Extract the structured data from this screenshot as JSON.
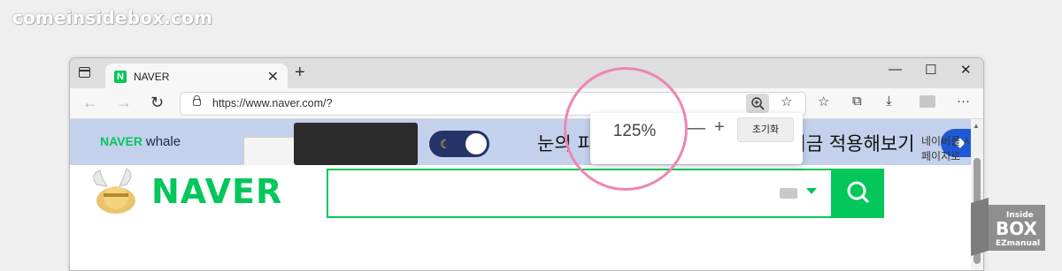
{
  "watermark": "comeinsidebox.com",
  "browser": {
    "tab": {
      "title": "NAVER",
      "favicon": "N",
      "close": "✕"
    },
    "new_tab": "+",
    "window_controls": [
      "—",
      "☐",
      "✕"
    ],
    "address": "https://www.naver.com/?",
    "nav": {
      "back": "←",
      "forward": "→",
      "refresh": "↻"
    },
    "toolbar_icons": {
      "favorites_add": "☆",
      "favorites": "☆",
      "collections": "⧉",
      "downloads": "⤓",
      "more": "···"
    }
  },
  "zoom_popup": {
    "level": "125%",
    "minus": "—",
    "plus": "+",
    "reset": "초기화"
  },
  "banner": {
    "brand_naver": "NAVER",
    "brand_whale": "whale",
    "text": "눈의 피로를 덜어주는 다크모드, 지금 적용해보기",
    "colors": {
      "background": "#c4d1ec",
      "toggle": "#243368",
      "button": "#1f5ad6"
    }
  },
  "page": {
    "naver_link": "네이버를 시작페이지로",
    "logo": "NAVER"
  },
  "badge": {
    "line1": "Inside",
    "line2": "BOX",
    "line3": "EZmanual"
  },
  "colors": {
    "naver_green": "#03c75a",
    "ring": "#ee86b3"
  }
}
